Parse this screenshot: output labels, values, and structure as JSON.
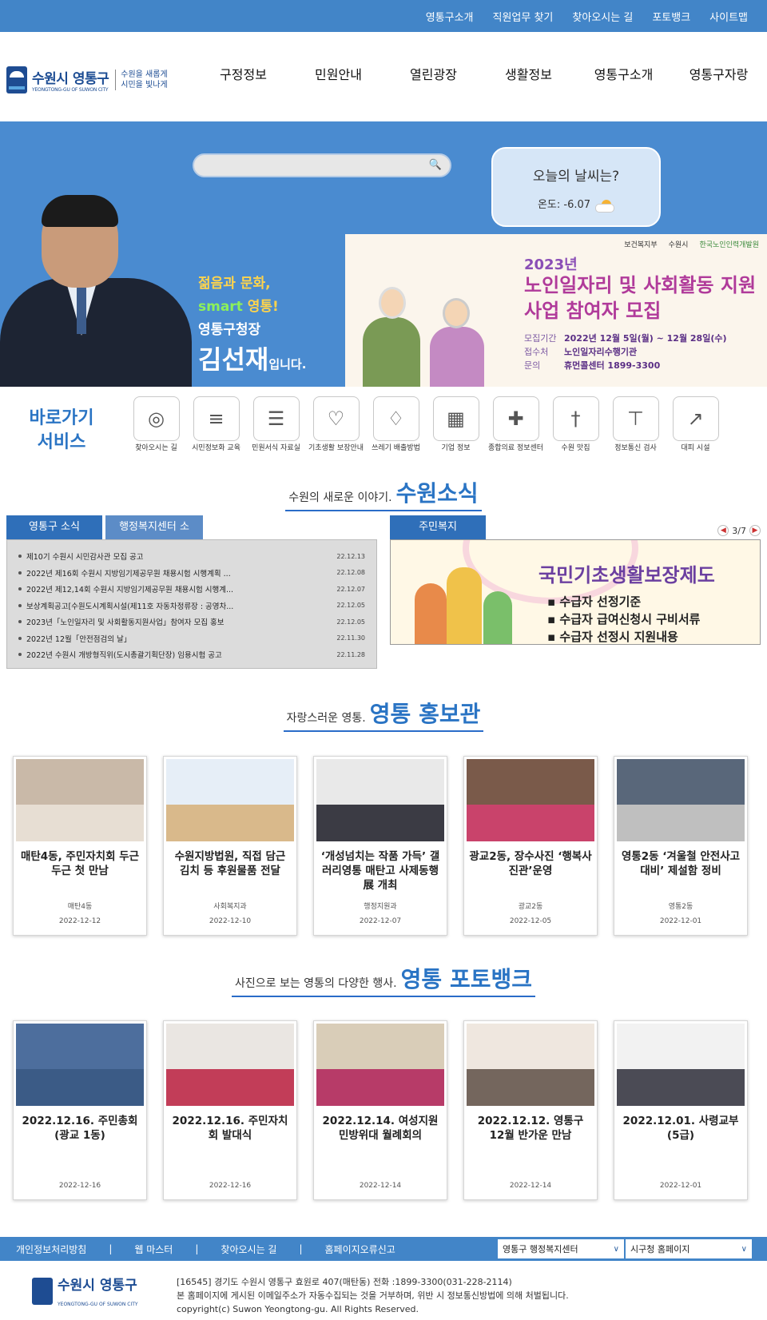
{
  "top_links": [
    "영통구소개",
    "직원업무 찾기",
    "찾아오시는 길",
    "포토뱅크",
    "사이트맵"
  ],
  "logo": {
    "name": "수원시 영통구",
    "sub": "YEONGTONG-GU OF SUWON CITY",
    "slogan_1": "수원을 새롭게",
    "slogan_2": "시민을 빛나게"
  },
  "gnb": [
    "구정정보",
    "민원안내",
    "열린광장",
    "생활정보",
    "영통구소개",
    "영통구자랑"
  ],
  "search": {
    "placeholder": ""
  },
  "weather": {
    "title": "오늘의 날씨는?",
    "temp_label": "온도: -6.07",
    "icon": "partly-cloudy-icon"
  },
  "greeting": {
    "line1": "젊음과 문화,",
    "line2a": "smart",
    "line2b": " 영통!",
    "line3": "영통구청장",
    "name": "김선재",
    "suffix": "입니다."
  },
  "banner": {
    "logo1": "보건복지부",
    "logo2": "수원시",
    "logo3": "한국노인인력개발원",
    "year": "2023년",
    "title": "노인일자리 및 사회활동 지원사업 참여자 모집",
    "k1": "모집기간",
    "v1": "2022년 12월 5일(월) ~ 12월 28일(수)",
    "k2": "접수처",
    "v2": "노인일자리수행기관",
    "k3": "문의",
    "v3": "휴먼콜센터 1899-3300"
  },
  "quick": {
    "title_1": "바로가기",
    "title_2": "서비스",
    "items": [
      {
        "label": "찾아오시는 길",
        "icon": "compass-icon"
      },
      {
        "label": "시민정보화 교육",
        "icon": "book-icon"
      },
      {
        "label": "민원서식 자료실",
        "icon": "document-icon"
      },
      {
        "label": "기초생활 보장안내",
        "icon": "heart-icon"
      },
      {
        "label": "쓰레기 배출방법",
        "icon": "trash-bag-icon"
      },
      {
        "label": "기업 정보",
        "icon": "building-icon"
      },
      {
        "label": "종합의료 정보센터",
        "icon": "hospital-icon"
      },
      {
        "label": "수원 맛집",
        "icon": "fork-knife-icon"
      },
      {
        "label": "정보통신 검사",
        "icon": "antenna-icon"
      },
      {
        "label": "대피 시설",
        "icon": "evacuation-icon"
      }
    ]
  },
  "news_section": {
    "small": "수원의 새로운 이야기.",
    "big": "수원소식"
  },
  "news_tabs": [
    "영통구 소식",
    "행정복지센터 소식"
  ],
  "news": [
    {
      "title": "제10기 수원시 시민감사관 모집 공고",
      "date": "22.12.13"
    },
    {
      "title": "2022년 제16회 수원시 지방임기제공무원 채용시험 시행계획 ...",
      "date": "22.12.08"
    },
    {
      "title": "2022년 제12,14회 수원시 지방임기제공무원 채용시험 시행계...",
      "date": "22.12.07"
    },
    {
      "title": "보상계획공고[수원도시계획시설(제11호 자동차정류장 : 공영차...",
      "date": "22.12.05"
    },
    {
      "title": "2023년「노인일자리 및 사회활동지원사업」참여자 모집 홍보",
      "date": "22.12.05"
    },
    {
      "title": "2022년 12월「안전점검의 날」",
      "date": "22.11.30"
    },
    {
      "title": "2022년 수원시 개방형직위(도시총괄기획단장) 임용시험 공고",
      "date": "22.11.28"
    }
  ],
  "welfare": {
    "tab": "주민복지",
    "page": "3/7",
    "title": "국민기초생활보장제도",
    "items": [
      "수급자 선정기준",
      "수급자 급여신청시 구비서류",
      "수급자 선정시 지원내용"
    ]
  },
  "promo_section": {
    "small": "자랑스러운 영통.",
    "big": "영통 홍보관"
  },
  "promo": [
    {
      "title": "매탄4동, 주민자치회 두근두근 첫 만남",
      "dept": "매탄4동",
      "date": "2022-12-12"
    },
    {
      "title": "수원지방법원, 직접 담근 김치 등 후원물품 전달",
      "dept": "사회복지과",
      "date": "2022-12-10"
    },
    {
      "title": "‘개성넘치는 작품 가득’ 갤러리영통 매탄고 사제동행展 개최",
      "dept": "행정지원과",
      "date": "2022-12-07"
    },
    {
      "title": "광교2동, 장수사진 ‘행복사진관’운영",
      "dept": "광교2동",
      "date": "2022-12-05"
    },
    {
      "title": "영통2동 ‘겨울철 안전사고 대비’ 제설함 정비",
      "dept": "영통2동",
      "date": "2022-12-01"
    }
  ],
  "photo_section": {
    "small": "사진으로 보는 영통의 다양한 행사.",
    "big": "영통 포토뱅크"
  },
  "photos": [
    {
      "title": "2022.12.16. 주민총회 (광교 1동)",
      "date": "2022-12-16"
    },
    {
      "title": "2022.12.16. 주민자치회 발대식",
      "date": "2022-12-16"
    },
    {
      "title": "2022.12.14. 여성지원 민방위대 월례회의",
      "date": "2022-12-14"
    },
    {
      "title": "2022.12.12. 영통구 12월 반가운 만남",
      "date": "2022-12-14"
    },
    {
      "title": "2022.12.01. 사령교부 (5급)",
      "date": "2022-12-01"
    }
  ],
  "footer_links": [
    "개인정보처리방침",
    "웹 마스터",
    "찾아오시는 길",
    "홈페이지오류신고"
  ],
  "footer_selects": [
    "영통구 행정복지센터",
    "시구청 홈페이지"
  ],
  "footer": {
    "line1": "[16545] 경기도 수원시 영통구 효원로 407(매탄동) 전화 :1899-3300(031-228-2114)",
    "line2": "본 홈페이지에 게시된 이메일주소가 자동수집되는 것을 거부하며, 위반 시 정보통신방법에 의해 처벌됩니다.",
    "line3": "copyright(c) Suwon Yeongtong-gu. All Rights Reserved."
  },
  "colors": {
    "brand": "#4285c8",
    "title_blue": "#2a74c4",
    "logo_navy": "#1c4c93"
  }
}
